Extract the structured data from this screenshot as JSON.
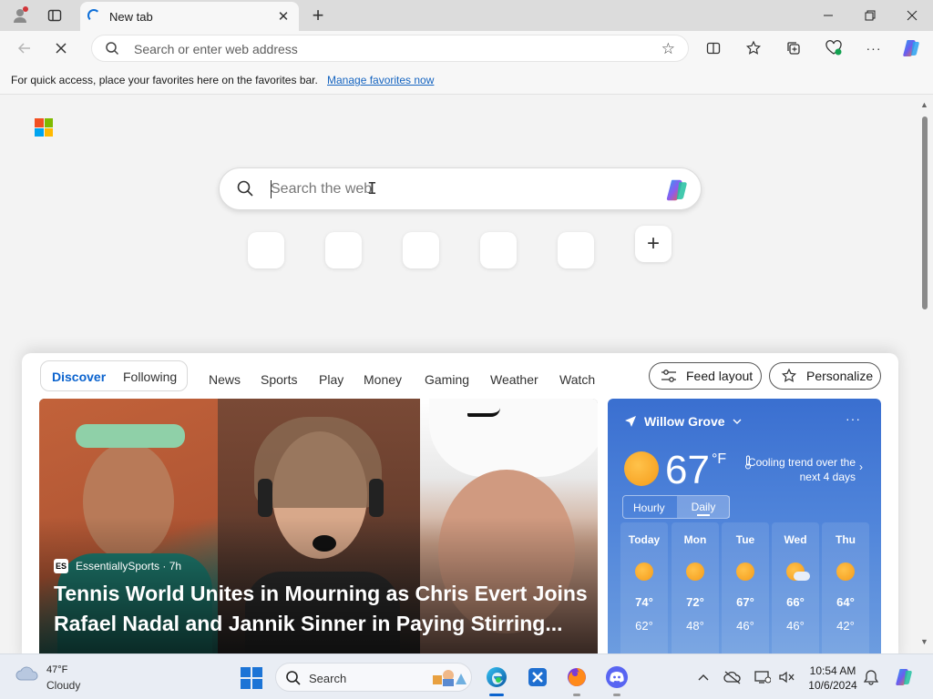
{
  "browser": {
    "tab": {
      "title": "New tab"
    },
    "address": {
      "placeholder": "Search or enter web address"
    },
    "favorites_bar": {
      "message": "For quick access, place your favorites here on the favorites bar.",
      "link": "Manage favorites now"
    }
  },
  "newtab": {
    "search": {
      "placeholder": "Search the web"
    },
    "feed": {
      "segments": {
        "discover": "Discover",
        "following": "Following"
      },
      "nav": [
        "News",
        "Sports",
        "Play",
        "Money",
        "Gaming",
        "Weather",
        "Watch"
      ],
      "feed_layout_label": "Feed layout",
      "personalize_label": "Personalize",
      "hero": {
        "source_logo": "ES",
        "source": "EssentiallySports · 7h",
        "title": "Tennis World Unites in Mourning as Chris Evert Joins Rafael Nadal and Jannik Sinner in Paying Stirring..."
      }
    },
    "weather": {
      "location": "Willow Grove",
      "more": "···",
      "temperature": "67",
      "unit": "°F",
      "trend": "Cooling trend over the next 4 days",
      "toggle": {
        "hourly": "Hourly",
        "daily": "Daily"
      },
      "days": [
        {
          "name": "Today",
          "icon": "sunny-icon",
          "high": "74°",
          "low": "62°"
        },
        {
          "name": "Mon",
          "icon": "sunny-icon",
          "high": "72°",
          "low": "48°"
        },
        {
          "name": "Tue",
          "icon": "sunny-icon",
          "high": "67°",
          "low": "46°"
        },
        {
          "name": "Wed",
          "icon": "partly-cloudy-icon",
          "high": "66°",
          "low": "46°"
        },
        {
          "name": "Thu",
          "icon": "sunny-icon",
          "high": "64°",
          "low": "42°"
        }
      ]
    }
  },
  "taskbar": {
    "weather": {
      "temp": "47°F",
      "condition": "Cloudy"
    },
    "search_label": "Search",
    "clock": {
      "time": "10:54 AM",
      "date": "10/6/2024"
    }
  },
  "colors": {
    "accent": "#0b63ce",
    "weather_card": "#3a6fd0",
    "sun": "#f59b1a",
    "link": "#1564c0"
  }
}
